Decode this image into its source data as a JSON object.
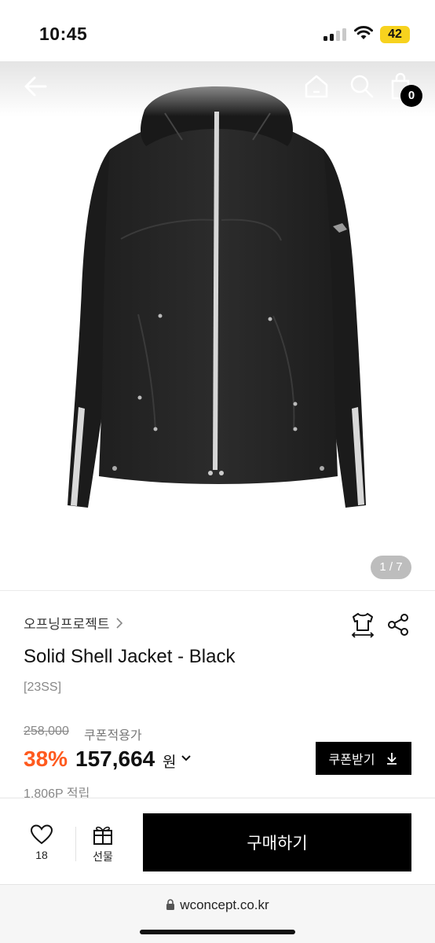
{
  "status": {
    "time": "10:45",
    "battery": "42"
  },
  "product_nav": {
    "cart_count": "0"
  },
  "gallery": {
    "page_indicator": "1 / 7",
    "image_alt": "Solid Shell Jacket - Black"
  },
  "product": {
    "brand": "오프닝프로젝트",
    "title": "Solid Shell Jacket - Black",
    "season": "[23SS]",
    "original_price": "258,000",
    "coupon_note": "쿠폰적용가",
    "discount": "38%",
    "sale_price": "157,664",
    "currency": "원",
    "coupon_button": "쿠폰받기",
    "points": "1,806P 적립"
  },
  "bottom_bar": {
    "like_count": "18",
    "gift_label": "선물",
    "buy_label": "구매하기"
  },
  "browser": {
    "url": "wconcept.co.kr"
  },
  "colors": {
    "discount": "#ff5a1e",
    "battery": "#f7d21e",
    "primary": "#000000"
  }
}
